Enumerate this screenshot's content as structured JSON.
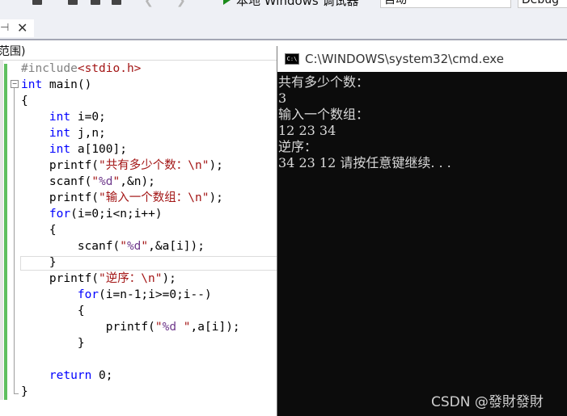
{
  "toolbar": {
    "debug_label": "本地 Windows 调试器",
    "auto_combo": "自动",
    "config_combo": "Debug"
  },
  "tabstrip": {
    "pin_glyph": "⊣",
    "close_glyph": "✕"
  },
  "scopebar": {
    "text": "范围)"
  },
  "code": {
    "lines": [
      [
        {
          "t": "#include",
          "c": "pp"
        },
        {
          "t": "<stdio.h>",
          "c": "pph"
        }
      ],
      [
        {
          "t": "int",
          "c": "kw"
        },
        {
          "t": " main()",
          "c": ""
        }
      ],
      [
        {
          "t": "{",
          "c": ""
        }
      ],
      [
        {
          "t": "    ",
          "c": ""
        },
        {
          "t": "int",
          "c": "kw"
        },
        {
          "t": " i=0;",
          "c": ""
        }
      ],
      [
        {
          "t": "    ",
          "c": ""
        },
        {
          "t": "int",
          "c": "kw"
        },
        {
          "t": " j,n;",
          "c": ""
        }
      ],
      [
        {
          "t": "    ",
          "c": ""
        },
        {
          "t": "int",
          "c": "kw"
        },
        {
          "t": " a[100];",
          "c": ""
        }
      ],
      [
        {
          "t": "    printf(",
          "c": ""
        },
        {
          "t": "\"共有多少个数：\\n\"",
          "c": "str"
        },
        {
          "t": ");",
          "c": ""
        }
      ],
      [
        {
          "t": "    scanf(",
          "c": ""
        },
        {
          "t": "\"",
          "c": "str"
        },
        {
          "t": "%d",
          "c": "fmt"
        },
        {
          "t": "\"",
          "c": "str"
        },
        {
          "t": ",&n);",
          "c": ""
        }
      ],
      [
        {
          "t": "    printf(",
          "c": ""
        },
        {
          "t": "\"输入一个数组：\\n\"",
          "c": "str"
        },
        {
          "t": ");",
          "c": ""
        }
      ],
      [
        {
          "t": "    ",
          "c": ""
        },
        {
          "t": "for",
          "c": "kw"
        },
        {
          "t": "(i=0;i<n;i++)",
          "c": ""
        }
      ],
      [
        {
          "t": "    {",
          "c": ""
        }
      ],
      [
        {
          "t": "        scanf(",
          "c": ""
        },
        {
          "t": "\"",
          "c": "str"
        },
        {
          "t": "%d",
          "c": "fmt"
        },
        {
          "t": "\"",
          "c": "str"
        },
        {
          "t": ",&a[i]);",
          "c": ""
        }
      ],
      [
        {
          "t": "    }",
          "c": ""
        }
      ],
      [
        {
          "t": "    printf(",
          "c": ""
        },
        {
          "t": "\"逆序：\\n\"",
          "c": "str"
        },
        {
          "t": ");",
          "c": ""
        }
      ],
      [
        {
          "t": "        ",
          "c": ""
        },
        {
          "t": "for",
          "c": "kw"
        },
        {
          "t": "(i=n-1;i>=0;i--)",
          "c": ""
        }
      ],
      [
        {
          "t": "        {",
          "c": ""
        }
      ],
      [
        {
          "t": "            printf(",
          "c": ""
        },
        {
          "t": "\"",
          "c": "str"
        },
        {
          "t": "%d",
          "c": "fmt"
        },
        {
          "t": " \"",
          "c": "str"
        },
        {
          "t": ",a[i]);",
          "c": ""
        }
      ],
      [
        {
          "t": "        }",
          "c": ""
        }
      ],
      [],
      [
        {
          "t": "    ",
          "c": ""
        },
        {
          "t": "return",
          "c": "kw"
        },
        {
          "t": " 0;",
          "c": ""
        }
      ],
      [
        {
          "t": "}",
          "c": ""
        }
      ]
    ]
  },
  "cmd": {
    "title": "C:\\WINDOWS\\system32\\cmd.exe",
    "icon_text": "C:\\",
    "output_lines": [
      "共有多少个数：",
      "3",
      "输入一个数组：",
      "12 23 34",
      "逆序：",
      "34 23 12 请按任意键继续. . ."
    ],
    "watermark": "CSDN @發財發財"
  }
}
